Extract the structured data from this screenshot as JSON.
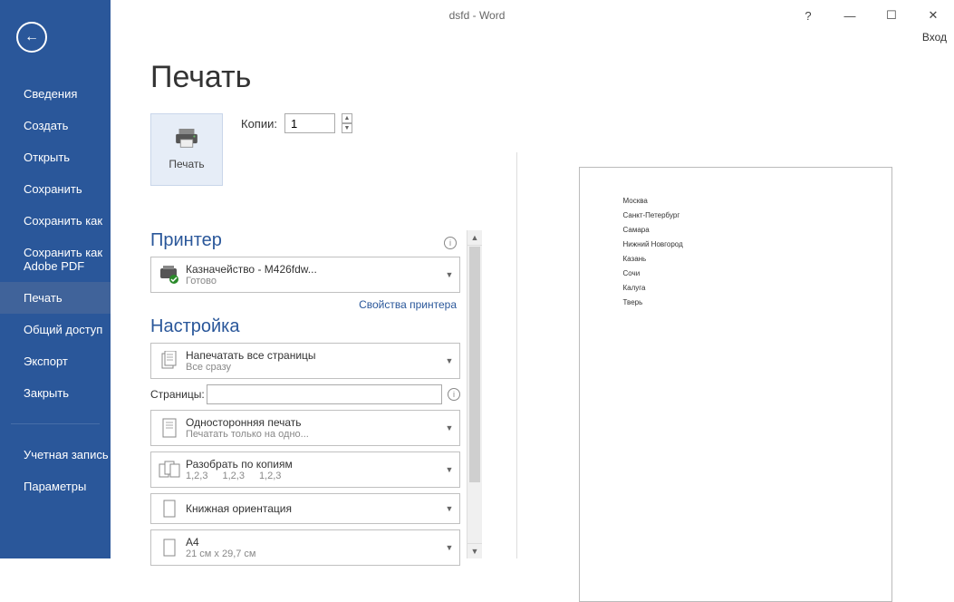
{
  "titlebar": {
    "title": "dsfd - Word",
    "sublabel": "Вход"
  },
  "sidebar": {
    "items": [
      "Сведения",
      "Создать",
      "Открыть",
      "Сохранить",
      "Сохранить как",
      "Сохранить как Adobe PDF",
      "Печать",
      "Общий доступ",
      "Экспорт",
      "Закрыть"
    ],
    "footer": [
      "Учетная запись",
      "Параметры"
    ],
    "active_index": 6
  },
  "print": {
    "page_title": "Печать",
    "button_label": "Печать",
    "copies_label": "Копии:",
    "copies_value": "1"
  },
  "printer_section": {
    "heading": "Принтер",
    "selected": {
      "name": "Казначейство - M426fdw...",
      "status": "Готово"
    },
    "link": "Свойства принтера"
  },
  "settings_section": {
    "heading": "Настройка",
    "range": {
      "line1": "Напечатать все страницы",
      "line2": "Все сразу"
    },
    "pages_label": "Страницы:",
    "pages_value": "",
    "sided": {
      "line1": "Односторонняя печать",
      "line2": "Печатать только на одно..."
    },
    "collate": {
      "line1": "Разобрать по копиям",
      "seq": [
        "1,2,3",
        "1,2,3",
        "1,2,3"
      ]
    },
    "orientation": {
      "line1": "Книжная ориентация"
    },
    "paper": {
      "line1": "A4",
      "line2": "21 см x 29,7 см"
    }
  },
  "preview": {
    "lines": [
      "Москва",
      "Санкт-Петербург",
      "Самара",
      "Нижний Новгород",
      "Казань",
      "Сочи",
      "Калуга",
      "Тверь"
    ]
  }
}
